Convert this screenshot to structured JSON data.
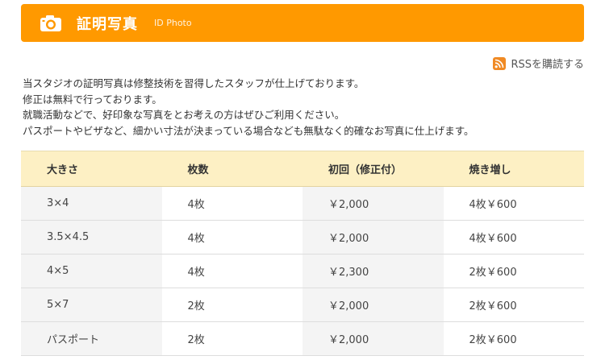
{
  "header": {
    "title": "証明写真",
    "subtitle": "ID Photo",
    "icon": "camera-icon"
  },
  "rss": {
    "label": "RSSを購読する",
    "icon": "rss-icon",
    "icon_color": "#f08a24"
  },
  "intro": {
    "lines": [
      "当スタジオの証明写真は修整技術を習得したスタッフが仕上げております。",
      "修正は無料で行っております。",
      "就職活動などで、好印象な写真をとお考えの方はぜひご利用ください。",
      "パスポートやビザなど、細かい寸法が決まっている場合なども無駄なく的確なお写真に仕上げます。"
    ]
  },
  "table": {
    "headers": [
      "大きさ",
      "枚数",
      "初回（修正付）",
      "焼き増し"
    ],
    "rows": [
      [
        "3×4",
        "4枚",
        "￥2,000",
        "4枚￥600"
      ],
      [
        "3.5×4.5",
        "4枚",
        "￥2,000",
        "4枚￥600"
      ],
      [
        "4×5",
        "4枚",
        "￥2,300",
        "2枚￥600"
      ],
      [
        "5×7",
        "2枚",
        "￥2,000",
        "2枚￥600"
      ],
      [
        "パスポート",
        "2枚",
        "￥2,000",
        "2枚￥600"
      ]
    ]
  },
  "colors": {
    "header_bg": "#ff9900",
    "table_header_bg": "#fdf0c4",
    "row_shade": "#f4f4f4"
  }
}
